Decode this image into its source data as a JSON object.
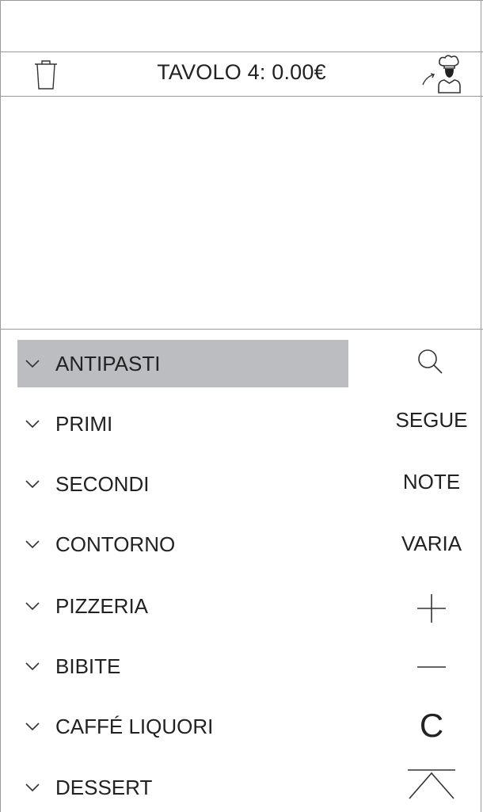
{
  "header": {
    "title": "TAVOLO 4: 0.00€",
    "trash_icon": "trash-icon",
    "send_icon": "chef-send-icon"
  },
  "order": {
    "items": []
  },
  "categories": [
    {
      "label": "ANTIPASTI",
      "selected": true
    },
    {
      "label": "PRIMI",
      "selected": false
    },
    {
      "label": "SECONDI",
      "selected": false
    },
    {
      "label": "CONTORNO",
      "selected": false
    },
    {
      "label": "PIZZERIA",
      "selected": false
    },
    {
      "label": "BIBITE",
      "selected": false
    },
    {
      "label": "CAFFÉ LIQUORI",
      "selected": false
    },
    {
      "label": "DESSERT",
      "selected": false
    }
  ],
  "actions": {
    "search_icon": "search-icon",
    "segue": "SEGUE",
    "note": "NOTE",
    "varia": "VARIA",
    "plus_icon": "plus-icon",
    "minus_icon": "minus-icon",
    "clear": "C",
    "collapse_icon": "chevron-up-icon"
  },
  "colors": {
    "selected_background": "#bcbdc0",
    "border": "#9a9a9a",
    "text": "#222222"
  }
}
